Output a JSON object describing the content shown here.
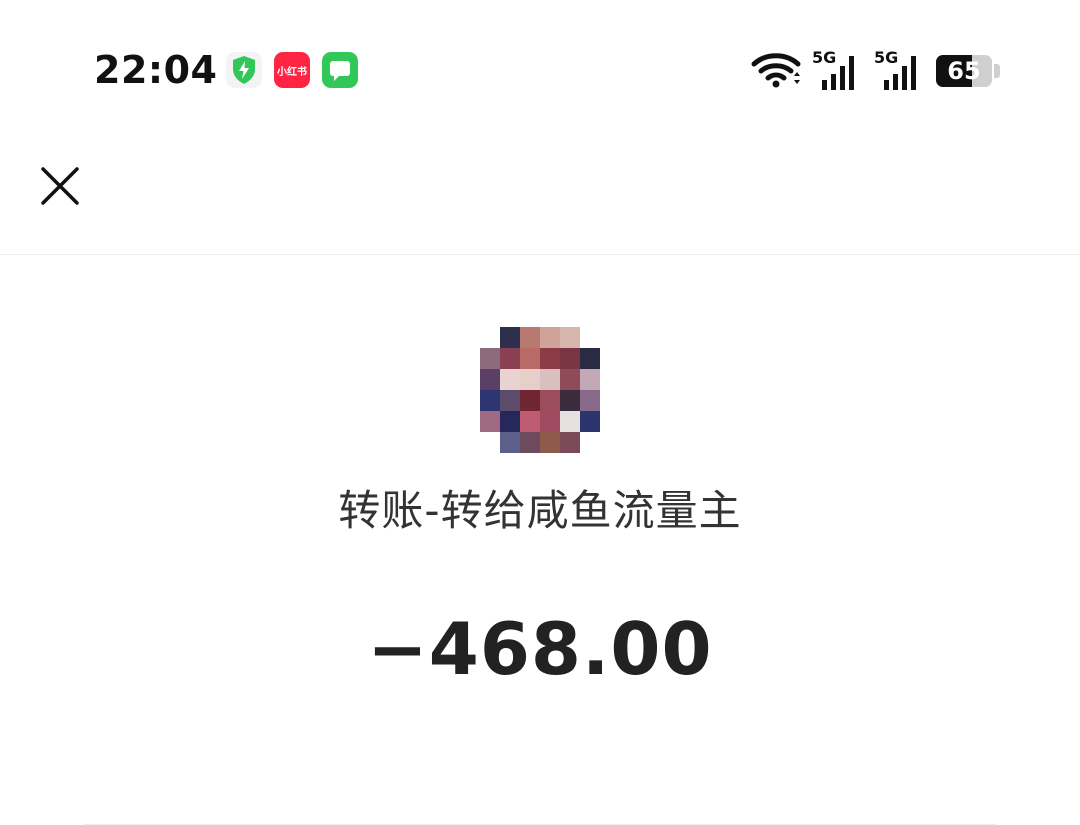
{
  "status_bar": {
    "time": "22:04",
    "app_icons": [
      {
        "name": "shield-icon",
        "color": "#33c759"
      },
      {
        "name": "xiaohongshu-icon",
        "label": "小红书",
        "color": "#ff2442"
      },
      {
        "name": "message-icon",
        "color": "#33c759"
      }
    ],
    "network_label_1": "5G",
    "network_label_2": "5G",
    "battery_percent": "65",
    "battery_level": 0.65
  },
  "nav": {
    "close_icon": "close-icon"
  },
  "transfer": {
    "title": "转账-转给咸鱼流量主",
    "amount": "−468.00",
    "avatar": "blurred-avatar"
  }
}
